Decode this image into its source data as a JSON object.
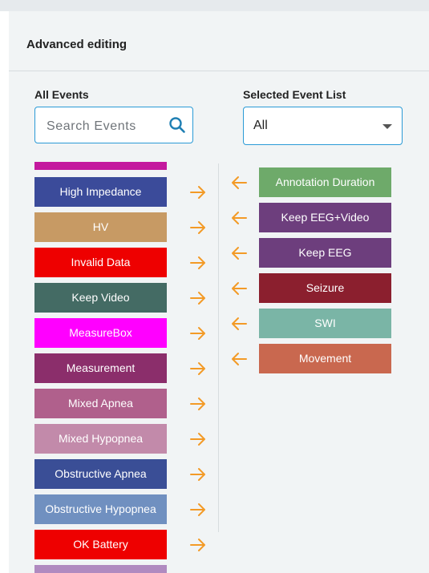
{
  "header": {
    "title": "Advanced editing"
  },
  "all_events": {
    "title": "All Events",
    "search_placeholder": "Search Events",
    "items": [
      {
        "label": "High Impedance",
        "color": "#3b4b9a"
      },
      {
        "label": "HV",
        "color": "#c79a64"
      },
      {
        "label": "Invalid Data",
        "color": "#ee0000"
      },
      {
        "label": "Keep Video",
        "color": "#446b64"
      },
      {
        "label": "MeasureBox",
        "color": "#ff00ff"
      },
      {
        "label": "Measurement",
        "color": "#8b2e6b"
      },
      {
        "label": "Mixed Apnea",
        "color": "#b0608c"
      },
      {
        "label": "Mixed Hypopnea",
        "color": "#c28aaa"
      },
      {
        "label": "Obstructive Apnea",
        "color": "#3a4e96"
      },
      {
        "label": "Obstructive Hypopnea",
        "color": "#7090c0"
      },
      {
        "label": "OK Battery",
        "color": "#ee0000"
      }
    ],
    "top_stub_color": "#c4199e",
    "bottom_stub_color": "#b08ac0"
  },
  "selected_events": {
    "title": "Selected Event List",
    "filter_value": "All",
    "items": [
      {
        "label": "Annotation Duration",
        "color": "#6eaa6a"
      },
      {
        "label": "Keep EEG+Video",
        "color": "#6d3e7d"
      },
      {
        "label": "Keep EEG",
        "color": "#6d3e7d"
      },
      {
        "label": "Seizure",
        "color": "#8b1f2e"
      },
      {
        "label": "SWI",
        "color": "#7ab5a6"
      },
      {
        "label": "Movement",
        "color": "#c9684f"
      }
    ]
  },
  "accent_color": "#2a9ad6",
  "arrow_color": "#f39a26"
}
